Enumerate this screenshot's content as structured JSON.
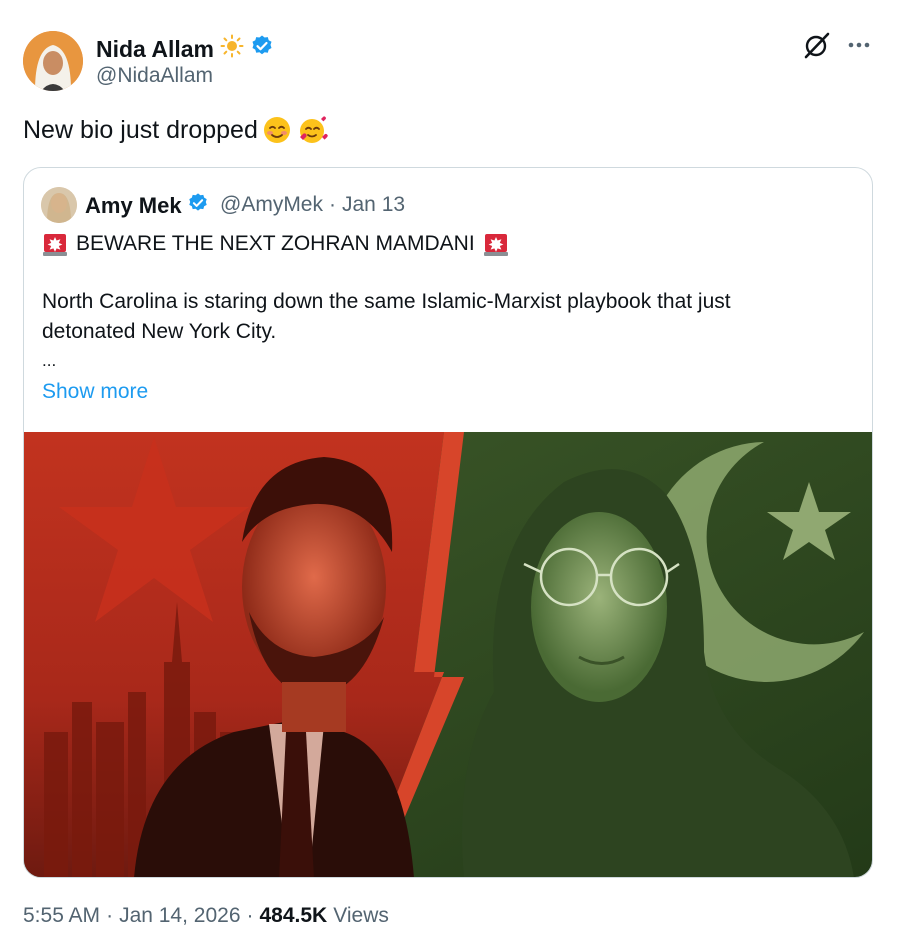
{
  "tweet": {
    "author": {
      "name": "Nida Allam",
      "handle": "@NidaAllam",
      "name_emoji": "sun-icon"
    },
    "text": "New bio just dropped",
    "text_emojis": [
      "smiling-face-icon",
      "smiling-face-with-hearts-icon"
    ],
    "footer": {
      "time": "5:55 AM",
      "sep1": "·",
      "date": "Jan 14, 2026",
      "sep2": "·",
      "views_count": "484.5K",
      "views_label": "Views"
    }
  },
  "quote": {
    "author": {
      "name": "Amy Mek",
      "handle": "@AmyMek",
      "sep": "·",
      "date": "Jan 13"
    },
    "headline": "BEWARE THE NEXT ZOHRAN MAMDANI",
    "body_line1": "North Carolina is staring down the same Islamic-Marxist playbook that just",
    "body_line2": "detonated New York City.",
    "ellipsis": "...",
    "show_more": "Show more"
  },
  "colors": {
    "verified": "#1d9bf0",
    "link": "#1d9bf0",
    "secondary_text": "#536471",
    "border": "#cfd9de"
  }
}
